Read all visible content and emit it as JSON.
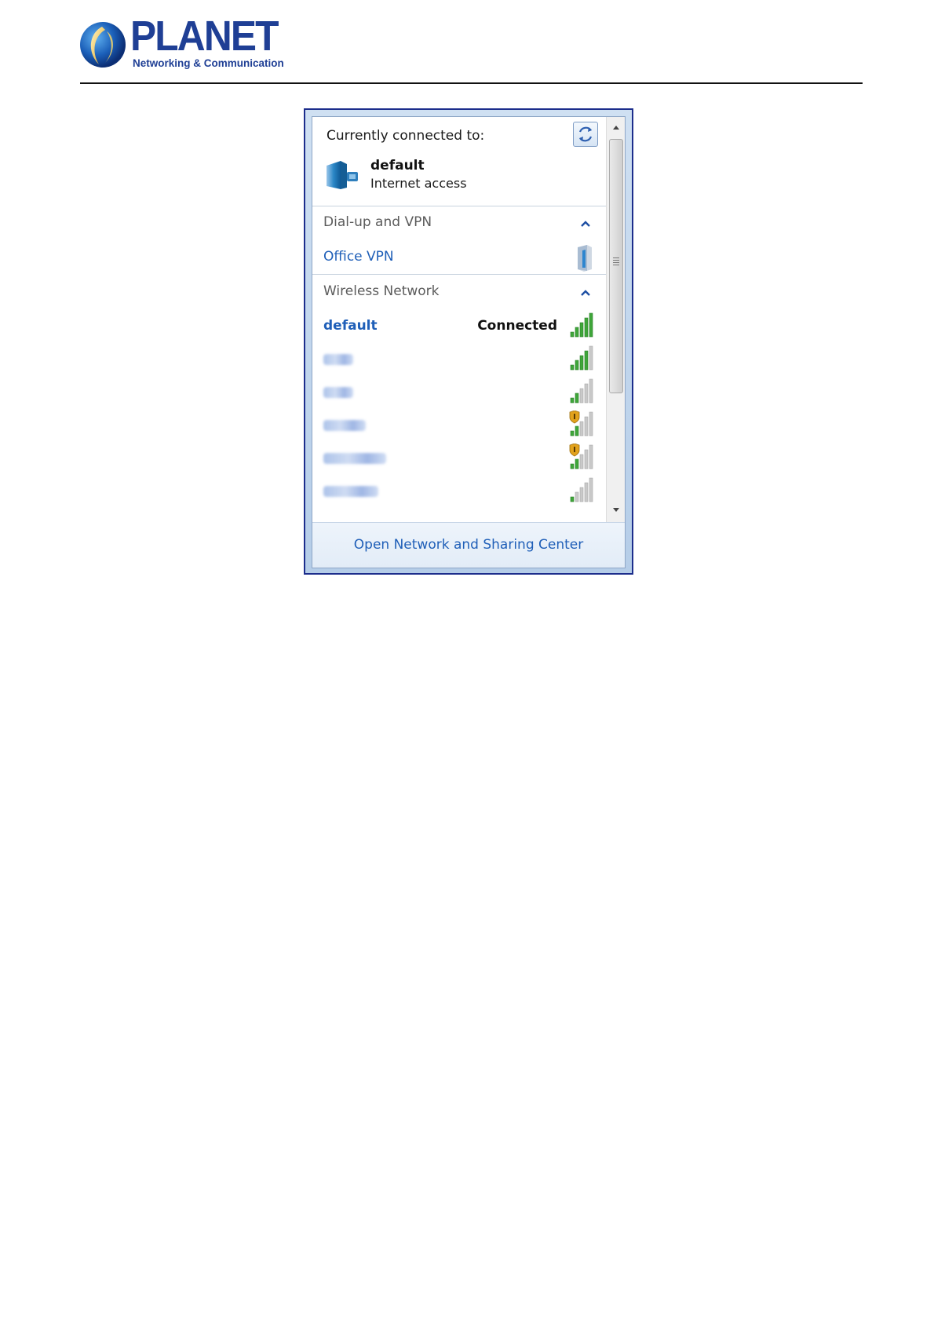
{
  "logo": {
    "word": "PLANET",
    "tagline": "Networking & Communication"
  },
  "flyout": {
    "current": {
      "title": "Currently connected to:",
      "name": "default",
      "status": "Internet access"
    },
    "dialup": {
      "header": "Dial-up and VPN",
      "items": [
        {
          "label": "Office VPN"
        }
      ]
    },
    "wireless": {
      "header": "Wireless Network",
      "connected": {
        "name": "default",
        "state": "Connected",
        "signal_bars": 5
      },
      "other_networks": [
        {
          "signal_bars": 4,
          "secured_warning": false
        },
        {
          "signal_bars": 2,
          "secured_warning": false
        },
        {
          "signal_bars": 2,
          "secured_warning": true
        },
        {
          "signal_bars": 2,
          "secured_warning": true
        },
        {
          "signal_bars": 1,
          "secured_warning": false
        }
      ]
    },
    "footer_link": "Open Network and Sharing Center"
  }
}
